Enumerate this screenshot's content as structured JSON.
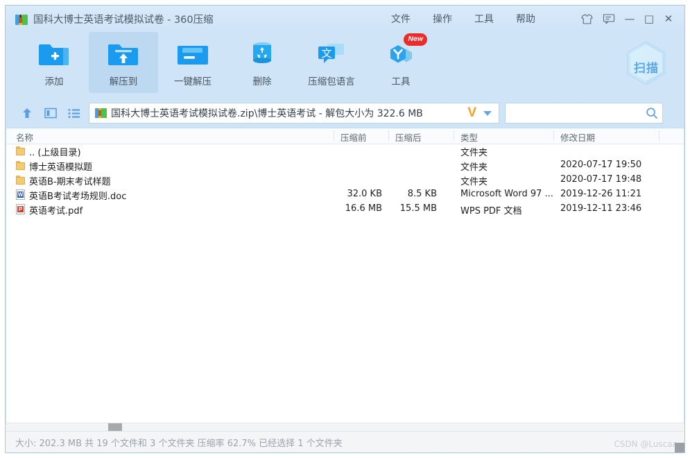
{
  "window": {
    "title": "国科大博士英语考试模拟试卷 - 360压缩",
    "app_icon": "archive-book-icon",
    "minimize_label": "—",
    "maximize_label": "□",
    "close_label": "✕"
  },
  "menu": {
    "items": [
      {
        "label": "文件",
        "name": "menu-file"
      },
      {
        "label": "操作",
        "name": "menu-action"
      },
      {
        "label": "工具",
        "name": "menu-tools"
      },
      {
        "label": "帮助",
        "name": "menu-help"
      }
    ],
    "skin_icon": "tshirt-icon",
    "feedback_icon": "feedback-icon"
  },
  "toolbar": {
    "buttons": [
      {
        "label": "添加",
        "icon": "folder-add-icon",
        "active": false,
        "badge": ""
      },
      {
        "label": "解压到",
        "icon": "folder-extract-icon",
        "active": true,
        "badge": ""
      },
      {
        "label": "一键解压",
        "icon": "folder-oneclick-icon",
        "active": false,
        "badge": ""
      },
      {
        "label": "删除",
        "icon": "trash-icon",
        "active": false,
        "badge": ""
      },
      {
        "label": "压缩包语言",
        "icon": "translate-icon",
        "active": false,
        "badge": ""
      },
      {
        "label": "工具",
        "icon": "tools-hex-icon",
        "active": false,
        "badge": "New"
      }
    ],
    "scan_label": "扫描",
    "scan_icon": "hexagon-scan-icon"
  },
  "address": {
    "up_icon": "up-arrow-icon",
    "view_icon": "preview-pane-icon",
    "list_icon": "list-view-icon",
    "path_icon": "archive-book-icon",
    "path": "国科大博士英语考试模拟试卷.zip\\博士英语考试 - 解包大小为 322.6 MB",
    "brand_mark": "V",
    "dropdown_icon": "chevron-down-icon"
  },
  "search": {
    "value": "",
    "placeholder": "",
    "icon": "search-icon"
  },
  "file_list": {
    "columns": [
      {
        "label": "名称",
        "name": "column-name"
      },
      {
        "label": "压缩前",
        "name": "column-size-before"
      },
      {
        "label": "压缩后",
        "name": "column-size-after"
      },
      {
        "label": "类型",
        "name": "column-type"
      },
      {
        "label": "修改日期",
        "name": "column-modified"
      }
    ],
    "rows": [
      {
        "name": ".. (上级目录)",
        "icon": "folder-icon",
        "size_before": "",
        "size_after": "",
        "type": "文件夹",
        "modified": ""
      },
      {
        "name": "博士英语模拟题",
        "icon": "folder-icon",
        "size_before": "",
        "size_after": "",
        "type": "文件夹",
        "modified": "2020-07-17 19:50"
      },
      {
        "name": "英语B-期末考试样题",
        "icon": "folder-icon",
        "size_before": "",
        "size_after": "",
        "type": "文件夹",
        "modified": "2020-07-17 19:48"
      },
      {
        "name": "英语B考试考场规则.doc",
        "icon": "word-icon",
        "size_before": "32.0 KB",
        "size_after": "8.5 KB",
        "type": "Microsoft Word 97 ...",
        "modified": "2019-12-26 11:21"
      },
      {
        "name": "英语考试.pdf",
        "icon": "pdf-icon",
        "size_before": "16.6 MB",
        "size_after": "15.5 MB",
        "type": "WPS PDF 文档",
        "modified": "2019-12-11 23:46"
      }
    ]
  },
  "status": {
    "text": "大小: 202.3 MB 共 19 个文件和 3 个文件夹 压缩率 62.7% 已经选择 1 个文件夹",
    "watermark": "CSDN @Luscaa"
  },
  "colors": {
    "window_chrome": "#cfe4f7",
    "accent_blue": "#2196f3",
    "badge_red": "#ec2b2b",
    "brand_orange": "#f2a01e",
    "folder_yellow": "#f5cb70"
  }
}
